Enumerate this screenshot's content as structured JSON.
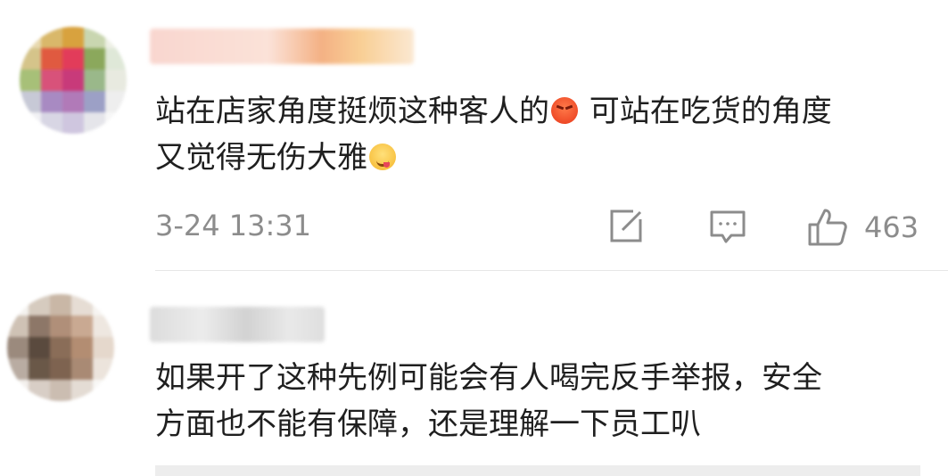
{
  "comments": [
    {
      "text_line1_part1": "站在店家角度挺烦这种客人的",
      "emoji1": "angry-emoji",
      "text_line1_part2": " 可站在吃货的角度",
      "text_line2": "又觉得无伤大雅",
      "emoji2": "yum-emoji",
      "time": "3-24 13:31",
      "like_count": "463"
    },
    {
      "text_line1": "如果开了这种先例可能会有人喝完反手举报，安全",
      "text_line2": "方面也不能有保障，还是理解一下员工叭"
    }
  ],
  "icons": {
    "repost": "repost-icon",
    "comment": "comment-icon",
    "like": "thumbs-up-icon"
  },
  "colors": {
    "text": "#1f1f1f",
    "meta": "#8c8c8c",
    "divider": "#e6e6e6"
  }
}
